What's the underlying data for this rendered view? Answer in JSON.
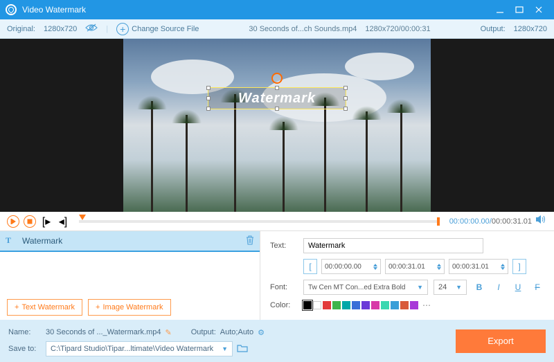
{
  "titlebar": {
    "title": "Video Watermark"
  },
  "toolbar": {
    "original_label": "Original:",
    "original_res": "1280x720",
    "change_source": "Change Source File",
    "filename": "30 Seconds of...ch Sounds.mp4",
    "file_res_dur": "1280x720/00:00:31",
    "output_label": "Output:",
    "output_res": "1280x720"
  },
  "watermark": {
    "text": "Watermark"
  },
  "playback": {
    "current": "00:00:00.00",
    "total": "00:00:31.01"
  },
  "watermark_list": {
    "item_label": "Watermark",
    "btn_text": "Text Watermark",
    "btn_image": "Image Watermark"
  },
  "props": {
    "text_label": "Text:",
    "text_value": "Watermark",
    "time_start": "00:00:00.00",
    "time_end": "00:00:31.01",
    "time_duration": "00:00:31.01",
    "font_label": "Font:",
    "font_name": "Tw Cen MT Con...ed Extra Bold",
    "font_size": "24",
    "color_label": "Color:",
    "colors": [
      "#000000",
      "#ffffff",
      "#e23939",
      "#3fb54b",
      "#00a8a8",
      "#3a6fd8",
      "#6a3ad8",
      "#d83aa8",
      "#3ad8b0",
      "#3a9fd8",
      "#d85a3a",
      "#a83ad8"
    ]
  },
  "bottom": {
    "name_label": "Name:",
    "name_value": "30 Seconds of ..._Watermark.mp4",
    "output_label": "Output:",
    "output_value": "Auto;Auto",
    "saveto_label": "Save to:",
    "saveto_value": "C:\\Tipard Studio\\Tipar...ltimate\\Video Watermark",
    "export": "Export"
  }
}
